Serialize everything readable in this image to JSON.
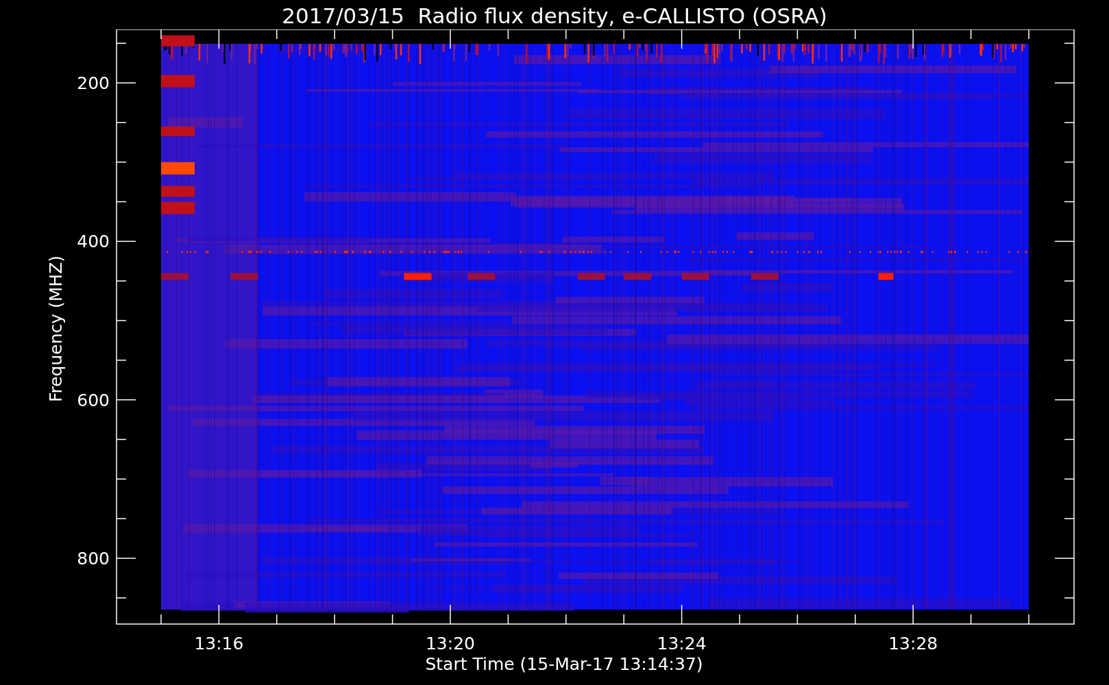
{
  "title": "2017/03/15  Radio flux density, e-CALLISTO (OSRA)",
  "y_axis": {
    "label": "Frequency (MHZ)",
    "ticks": [
      "200",
      "400",
      "600",
      "800"
    ]
  },
  "x_axis": {
    "label": "Start Time (15-Mar-17 13:14:37)",
    "ticks": [
      "13:16",
      "13:20",
      "13:24",
      "13:28"
    ]
  }
}
